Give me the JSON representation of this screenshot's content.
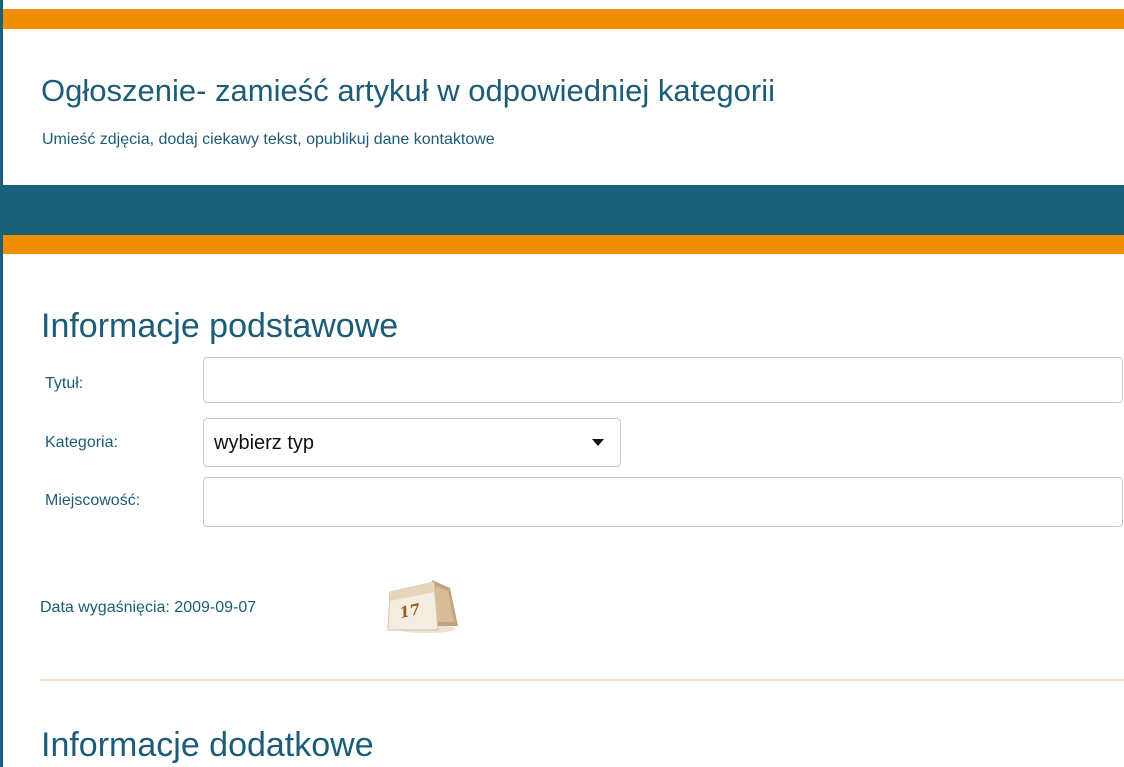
{
  "header": {
    "title": "Ogłoszenie- zamieść artykuł w odpowiedniej kategorii",
    "subtitle": "Umieść zdjęcia, dodaj ciekawy tekst, opublikuj dane kontaktowe"
  },
  "colors": {
    "brand_blue": "#1a6079",
    "accent_orange": "#ef8e00",
    "text_blue": "#1c5c77"
  },
  "basic_info": {
    "heading": "Informacje podstawowe",
    "title_label": "Tytuł:",
    "title_value": "",
    "category_label": "Kategoria:",
    "category_selected": "wybierz typ",
    "city_label": "Miejscowość:",
    "city_value": "",
    "expiry_label": "Data wygaśnięcia:",
    "expiry_date": "2009-09-07",
    "calendar_icon": "calendar-icon",
    "calendar_day": "17"
  },
  "additional_info": {
    "heading": "Informacje dodatkowe"
  }
}
